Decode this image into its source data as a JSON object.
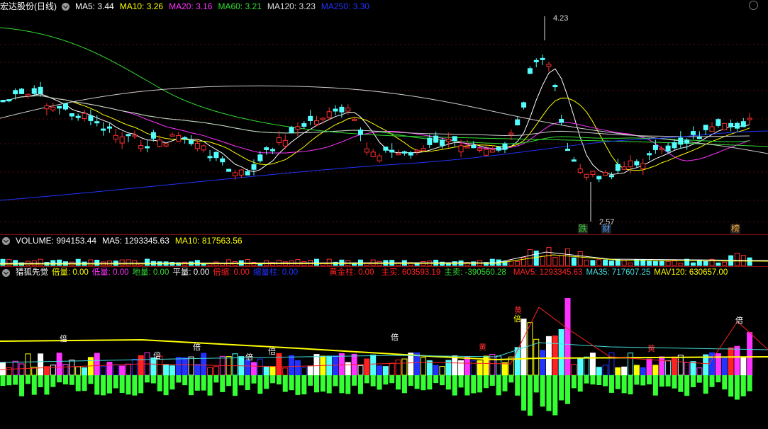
{
  "price_panel": {
    "title": "宏达股份(日线)",
    "ma": [
      {
        "label": "MA5: 3.44",
        "color": "#ffffff"
      },
      {
        "label": "MA10: 3.26",
        "color": "#ffff00"
      },
      {
        "label": "MA20: 3.16",
        "color": "#ff33ff"
      },
      {
        "label": "MA60: 3.21",
        "color": "#33dd33"
      },
      {
        "label": "MA120: 3.23",
        "color": "#dddddd"
      },
      {
        "label": "MA250: 3.30",
        "color": "#2233ff"
      }
    ],
    "high_label": "4.23",
    "low_label": "2.57",
    "event_markers": [
      {
        "text": "跌",
        "color": "#33dd33"
      },
      {
        "text": "财",
        "color": "#4499ff"
      },
      {
        "text": "榜",
        "color": "#ffaa33"
      }
    ]
  },
  "volume_panel": {
    "items": [
      {
        "label": "VOLUME: 994153.44",
        "color": "#ffffff"
      },
      {
        "label": "MA5: 1293345.63",
        "color": "#ffffff"
      },
      {
        "label": "MA10: 817563.56",
        "color": "#ffff00"
      }
    ]
  },
  "indicator_panel": {
    "items": [
      {
        "label": "猎狐先觉",
        "color": "#ffffff"
      },
      {
        "label": "倍量: 0.00",
        "color": "#ffff00"
      },
      {
        "label": "低量: 0.00",
        "color": "#ff33ff"
      },
      {
        "label": "地量: 0.00",
        "color": "#33dd33"
      },
      {
        "label": "平量: 0.00",
        "color": "#ffffff"
      },
      {
        "label": "倍缩: 0.00",
        "color": "#ff2222"
      },
      {
        "label": "缩量柱: 0.00",
        "color": "#2233ff"
      },
      {
        "label": "黄金柱: 0.00",
        "color": "#ff2222"
      },
      {
        "label": "主买: 603593.19",
        "color": "#ff2222"
      },
      {
        "label": "主卖: -390560.28",
        "color": "#33dd33"
      },
      {
        "label": "MAV5: 1293345.63",
        "color": "#ff2222"
      },
      {
        "label": "MA35: 717607.25",
        "color": "#44dddd"
      },
      {
        "label": "MAV120: 630657.00",
        "color": "#ffff00"
      }
    ],
    "bar_glyph_bei": "倍",
    "bar_glyph_huang": "黄"
  },
  "colors": {
    "up": "#ff3030",
    "down": "#54ffff",
    "grid": "#8b0f0f"
  }
}
